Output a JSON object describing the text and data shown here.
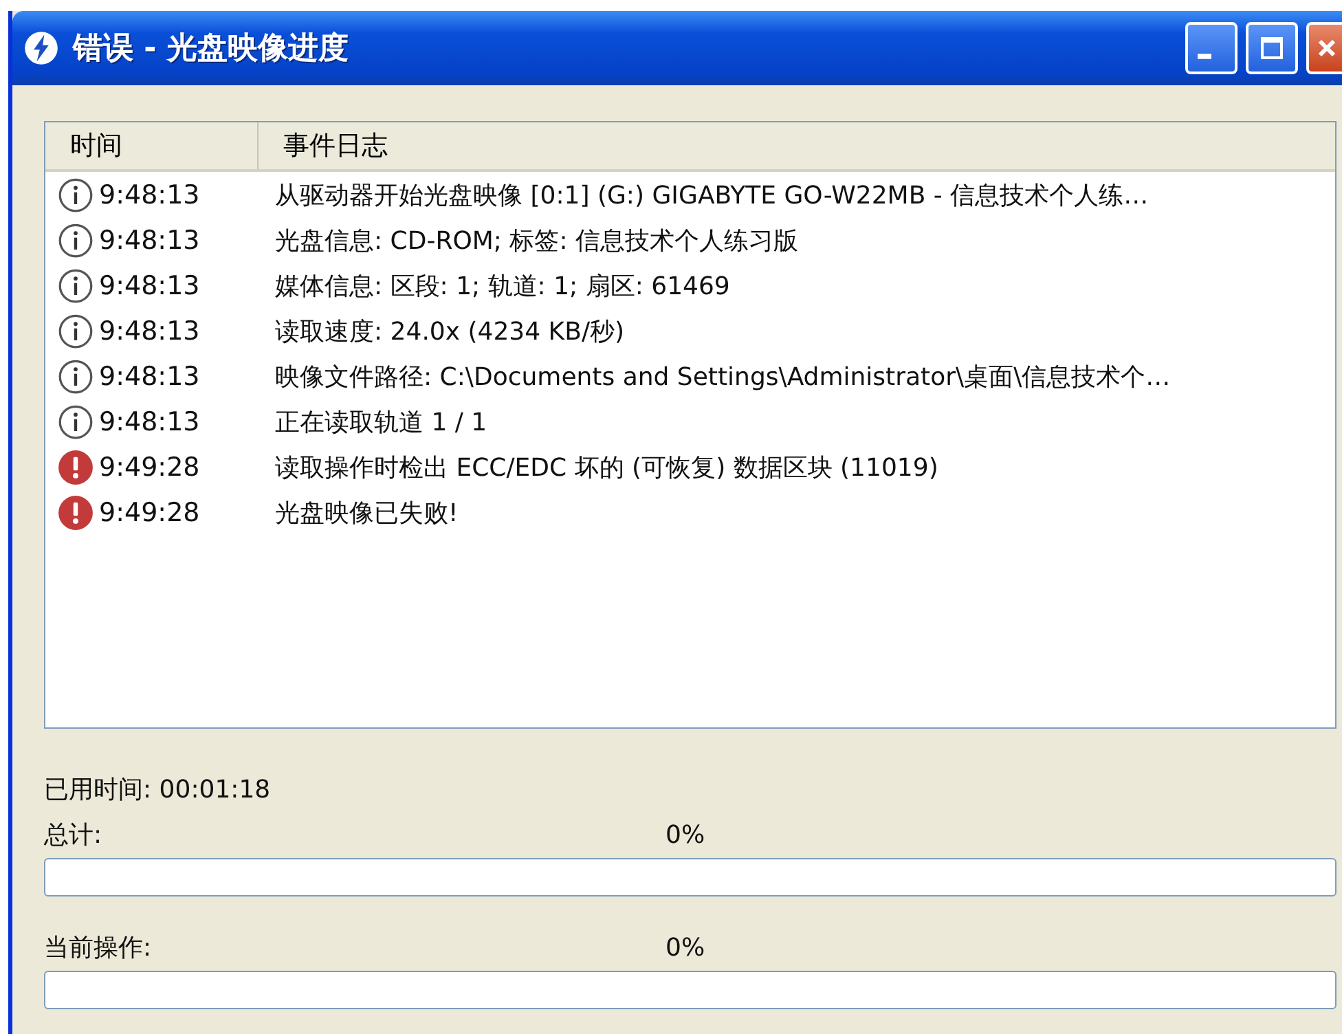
{
  "window": {
    "title": "错误 - 光盘映像进度"
  },
  "log": {
    "columns": [
      "时间",
      "事件日志"
    ],
    "rows": [
      {
        "kind": "info",
        "time": "9:48:13",
        "event": "从驱动器开始光盘映像 [0:1] (G:) GIGABYTE GO-W22MB - 信息技术个人练…"
      },
      {
        "kind": "info",
        "time": "9:48:13",
        "event": "光盘信息: CD-ROM; 标签: 信息技术个人练习版"
      },
      {
        "kind": "info",
        "time": "9:48:13",
        "event": "媒体信息: 区段: 1; 轨道: 1; 扇区: 61469"
      },
      {
        "kind": "info",
        "time": "9:48:13",
        "event": "读取速度: 24.0x (4234 KB/秒)"
      },
      {
        "kind": "info",
        "time": "9:48:13",
        "event": "映像文件路径: C:\\Documents and Settings\\Administrator\\桌面\\信息技术个…"
      },
      {
        "kind": "info",
        "time": "9:48:13",
        "event": "正在读取轨道 1 / 1"
      },
      {
        "kind": "error",
        "time": "9:49:28",
        "event": "读取操作时检出 ECC/EDC 坏的 (可恢复) 数据区块 (11019)"
      },
      {
        "kind": "error",
        "time": "9:49:28",
        "event": "光盘映像已失败!"
      }
    ]
  },
  "elapsed": "已用时间: 00:01:18",
  "progress": [
    {
      "label": "总计:",
      "percent": "0%"
    },
    {
      "label": "当前操作:",
      "percent": "0%"
    }
  ]
}
